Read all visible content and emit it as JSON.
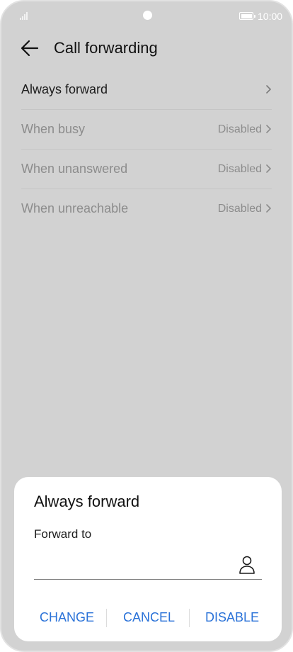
{
  "status_bar": {
    "time": "10:00",
    "icons": [
      "signal-icon",
      "camera-dot",
      "battery-icon"
    ]
  },
  "header": {
    "back_icon": "arrow-left-icon",
    "title": "Call forwarding"
  },
  "forwarding_options": [
    {
      "label": "Always forward",
      "status": "",
      "enabled": true
    },
    {
      "label": "When busy",
      "status": "Disabled",
      "enabled": false
    },
    {
      "label": "When unanswered",
      "status": "Disabled",
      "enabled": false
    },
    {
      "label": "When unreachable",
      "status": "Disabled",
      "enabled": false
    }
  ],
  "dialog": {
    "title": "Always forward",
    "field_label": "Forward to",
    "field_value": "",
    "contact_icon": "person-icon",
    "buttons": {
      "change": "CHANGE",
      "cancel": "CANCEL",
      "disable": "DISABLE"
    }
  },
  "colors": {
    "accent": "#2a72d8",
    "background_dimmed": "#d2d2d2",
    "dialog_surface": "#ffffff"
  }
}
